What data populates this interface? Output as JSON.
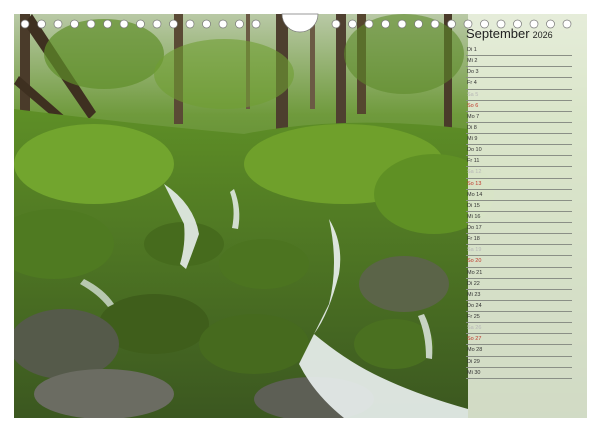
{
  "calendar": {
    "month": "September",
    "year": "2026"
  },
  "days": [
    {
      "label": "Di 1",
      "type": "weekday"
    },
    {
      "label": "Mi 2",
      "type": "weekday"
    },
    {
      "label": "Do 3",
      "type": "weekday"
    },
    {
      "label": "Fr 4",
      "type": "weekday"
    },
    {
      "label": "Sa 5",
      "type": "saturday"
    },
    {
      "label": "So 6",
      "type": "sunday"
    },
    {
      "label": "Mo 7",
      "type": "weekday"
    },
    {
      "label": "Di 8",
      "type": "weekday"
    },
    {
      "label": "Mi 9",
      "type": "weekday"
    },
    {
      "label": "Do 10",
      "type": "weekday"
    },
    {
      "label": "Fr 11",
      "type": "weekday"
    },
    {
      "label": "Sa 12",
      "type": "saturday"
    },
    {
      "label": "So 13",
      "type": "sunday"
    },
    {
      "label": "Mo 14",
      "type": "weekday"
    },
    {
      "label": "Di 15",
      "type": "weekday"
    },
    {
      "label": "Mi 16",
      "type": "weekday"
    },
    {
      "label": "Do 17",
      "type": "weekday"
    },
    {
      "label": "Fr 18",
      "type": "weekday"
    },
    {
      "label": "Sa 19",
      "type": "saturday"
    },
    {
      "label": "So 20",
      "type": "sunday"
    },
    {
      "label": "Mo 21",
      "type": "weekday"
    },
    {
      "label": "Di 22",
      "type": "weekday"
    },
    {
      "label": "Mi 23",
      "type": "weekday"
    },
    {
      "label": "Do 24",
      "type": "weekday"
    },
    {
      "label": "Fr 25",
      "type": "weekday"
    },
    {
      "label": "Sa 26",
      "type": "saturday"
    },
    {
      "label": "So 27",
      "type": "sunday"
    },
    {
      "label": "Mo 28",
      "type": "weekday"
    },
    {
      "label": "Di 29",
      "type": "weekday"
    },
    {
      "label": "Mi 30",
      "type": "weekday"
    }
  ],
  "colors": {
    "sunday": "#c0392b",
    "saturday": "#b7b7b7",
    "weekday": "#333333"
  }
}
